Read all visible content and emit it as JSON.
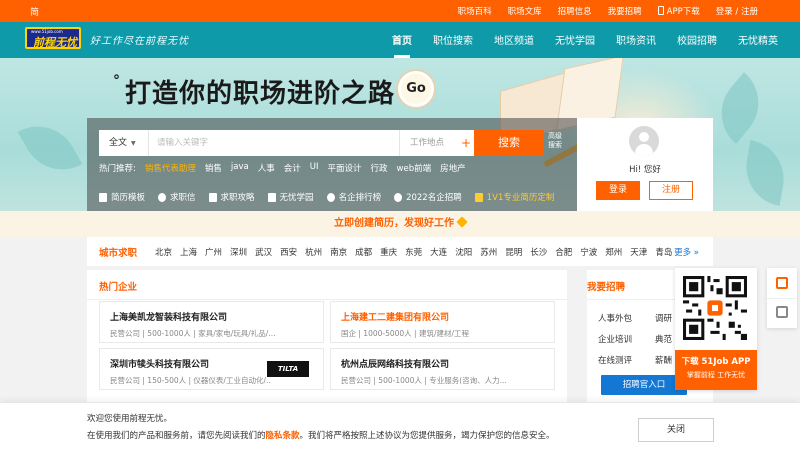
{
  "topbar": {
    "lang": "简",
    "links": [
      "职场百科",
      "职场文库",
      "招聘信息",
      "我要招聘"
    ],
    "app_download": "APP下载",
    "auth": "登录 / 注册"
  },
  "header": {
    "logo_text": "前程无忧",
    "logo_url": "www.51job.com",
    "slogan": "好工作尽在前程无忧",
    "nav": [
      "首页",
      "职位搜索",
      "地区频道",
      "无忧学园",
      "职场资讯",
      "校园招聘",
      "无忧精英"
    ]
  },
  "hero": {
    "headline": "打造你的职场进阶之路",
    "go_label": "Go"
  },
  "search": {
    "category": "全文",
    "placeholder": "请输入关键字",
    "location_label": "工作地点",
    "location_plus": "+",
    "button_label": "搜索",
    "advanced_label": "高级搜索",
    "hot_label": "热门推荐:",
    "hot_items": [
      "销售代表助理",
      "销售",
      "java",
      "人事",
      "会计",
      "UI",
      "平面设计",
      "行政",
      "web前端",
      "房地产"
    ],
    "tools": [
      "简历模板",
      "求职信",
      "求职攻略",
      "无忧学园",
      "名企排行榜",
      "2022名企招聘",
      "1V1专业简历定制"
    ]
  },
  "login_card": {
    "greeting": "Hi!  您好",
    "login_label": "登录",
    "register_label": "注册"
  },
  "promo": {
    "text": "立即创建简历，发现好工作"
  },
  "city_bar": {
    "label": "城市求职",
    "cities": [
      "北京",
      "上海",
      "广州",
      "深圳",
      "武汉",
      "西安",
      "杭州",
      "南京",
      "成都",
      "重庆",
      "东莞",
      "大连",
      "沈阳",
      "苏州",
      "昆明",
      "长沙",
      "合肥",
      "宁波",
      "郑州",
      "天津",
      "青岛"
    ],
    "more_label": "更多 »"
  },
  "companies": {
    "title": "热门企业",
    "items": [
      {
        "name": "上海美凯龙智装科技有限公司",
        "meta": "民营公司 | 500-1000人 | 家具/家电/玩具/礼品/..."
      },
      {
        "name": "上海建工二建集团有限公司",
        "meta": "国企 | 1000-5000人 | 建筑/建材/工程"
      },
      {
        "name": "深圳市犊头科技有限公司",
        "meta": "民营公司 | 150-500人 | 仪器仪表/工业自动化/...",
        "logo": "TILTA"
      },
      {
        "name": "杭州点辰网络科技有限公司",
        "meta": "民营公司 | 500-1000人 | 专业服务(咨询、人力..."
      }
    ]
  },
  "recruit": {
    "title": "我要招聘",
    "items": [
      "人事外包",
      "调研",
      "企业培训",
      "典范",
      "在线测评",
      "薪酬"
    ],
    "button_label": "招聘官入口"
  },
  "qr": {
    "line1": "下载 51Job APP",
    "line2": "掌握前程 工作无忧"
  },
  "cookie": {
    "line1": "欢迎您使用前程无忧。",
    "line2_prefix": "在使用我们的产品和服务前，请您先阅读我们的",
    "privacy_link": "隐私条款",
    "line2_suffix": "。我们将严格按照上述协议为您提供服务，竭力保护您的信息安全。",
    "close_label": "关闭"
  },
  "colors": {
    "accent": "#ff6000",
    "header_bg": "#0e9aa8",
    "link_blue": "#1477d4"
  }
}
